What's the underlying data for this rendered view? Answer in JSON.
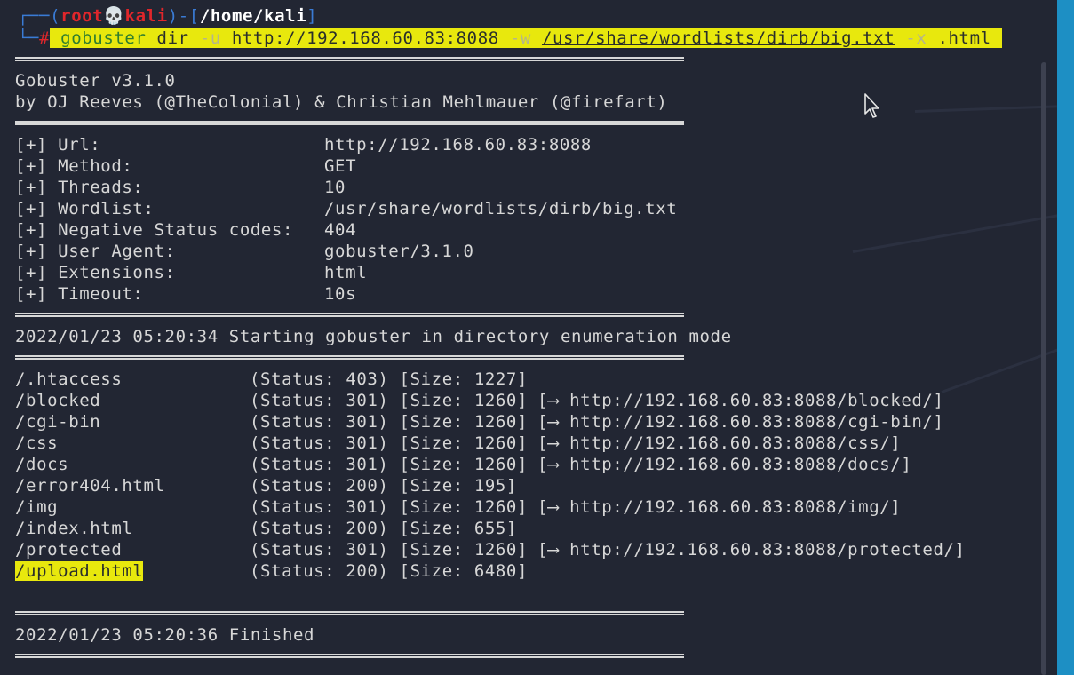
{
  "prompt": {
    "open": "┌──(",
    "user": "root",
    "skull": "💀",
    "host": "kali",
    "mid": ")-[",
    "path": "/home/kali",
    "close": "]",
    "second": "└─",
    "hash": "#"
  },
  "command": {
    "bin": "gobuster",
    "sub": "dir",
    "flag_u": "-u",
    "url": "http://192.168.60.83:8088",
    "flag_w": "-w",
    "wordlist": "/usr/share/wordlists/dirb/big.txt",
    "flag_x": "-x",
    "ext": ".html"
  },
  "banner": {
    "version": "Gobuster v3.1.0",
    "authors": "by OJ Reeves (@TheColonial) & Christian Mehlmauer (@firefart)"
  },
  "config": [
    {
      "label": "[+] Url:",
      "value": "http://192.168.60.83:8088"
    },
    {
      "label": "[+] Method:",
      "value": "GET"
    },
    {
      "label": "[+] Threads:",
      "value": "10"
    },
    {
      "label": "[+] Wordlist:",
      "value": "/usr/share/wordlists/dirb/big.txt"
    },
    {
      "label": "[+] Negative Status codes:",
      "value": "404"
    },
    {
      "label": "[+] User Agent:",
      "value": "gobuster/3.1.0"
    },
    {
      "label": "[+] Extensions:",
      "value": "html"
    },
    {
      "label": "[+] Timeout:",
      "value": "10s"
    }
  ],
  "start_msg": "2022/01/23 05:20:34 Starting gobuster in directory enumeration mode",
  "results": [
    {
      "path": "/.htaccess",
      "status": "(Status: 403) [Size: 1227]",
      "redirect": ""
    },
    {
      "path": "/blocked",
      "status": "(Status: 301) [Size: 1260]",
      "redirect": "[⟶ http://192.168.60.83:8088/blocked/]"
    },
    {
      "path": "/cgi-bin",
      "status": "(Status: 301) [Size: 1260]",
      "redirect": "[⟶ http://192.168.60.83:8088/cgi-bin/]"
    },
    {
      "path": "/css",
      "status": "(Status: 301) [Size: 1260]",
      "redirect": "[⟶ http://192.168.60.83:8088/css/]"
    },
    {
      "path": "/docs",
      "status": "(Status: 301) [Size: 1260]",
      "redirect": "[⟶ http://192.168.60.83:8088/docs/]"
    },
    {
      "path": "/error404.html",
      "status": "(Status: 200) [Size: 195]",
      "redirect": ""
    },
    {
      "path": "/img",
      "status": "(Status: 301) [Size: 1260]",
      "redirect": "[⟶ http://192.168.60.83:8088/img/]"
    },
    {
      "path": "/index.html",
      "status": "(Status: 200) [Size: 655]",
      "redirect": ""
    },
    {
      "path": "/protected",
      "status": "(Status: 301) [Size: 1260]",
      "redirect": "[⟶ http://192.168.60.83:8088/protected/]"
    },
    {
      "path": "/upload.html",
      "status": "(Status: 200) [Size: 6480]",
      "redirect": ""
    }
  ],
  "finish_msg": "2022/01/23 05:20:36 Finished"
}
